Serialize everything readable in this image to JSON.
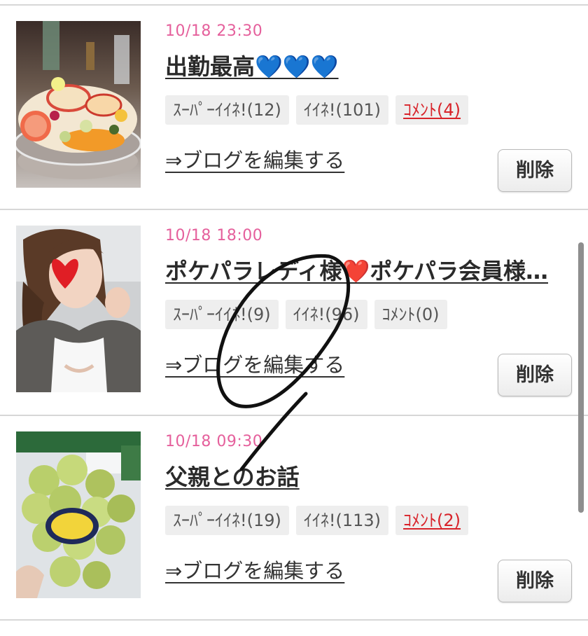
{
  "posts": [
    {
      "date": "10/18 23:30",
      "title": "出勤最高💙💙💙",
      "badges": {
        "super_like": "ｽｰﾊﾟｰｲｲﾈ!(12)",
        "like": "ｲｲﾈ!(101)",
        "comment": "ｺﾒﾝﾄ(4)"
      },
      "comment_active": true,
      "edit_link": "⇒ブログを編集する",
      "delete_label": "削除"
    },
    {
      "date": "10/18 18:00",
      "title": "ポケパラレディ様❤️ポケパラ会員様…",
      "badges": {
        "super_like": "ｽｰﾊﾟｰｲｲﾈ!(9)",
        "like": "ｲｲﾈ!(96)",
        "comment": "ｺﾒﾝﾄ(0)"
      },
      "comment_active": false,
      "edit_link": "⇒ブログを編集する",
      "delete_label": "削除"
    },
    {
      "date": "10/18 09:30",
      "title": "父親とのお話",
      "badges": {
        "super_like": "ｽｰﾊﾟｰｲｲﾈ!(19)",
        "like": "ｲｲﾈ!(113)",
        "comment": "ｺﾒﾝﾄ(2)"
      },
      "comment_active": true,
      "edit_link": "⇒ブログを編集する",
      "delete_label": "削除"
    }
  ],
  "colors": {
    "date": "#e5609c",
    "comment_active": "#d8232a",
    "badge_bg": "#eeeeee",
    "divider": "#d7d7d7"
  },
  "icons": {
    "thumb_1": "fruit-platter-photo",
    "thumb_2": "woman-heart-sticker-photo",
    "thumb_3": "grapes-photo",
    "annotation": "hand-drawn-circle-mark"
  }
}
